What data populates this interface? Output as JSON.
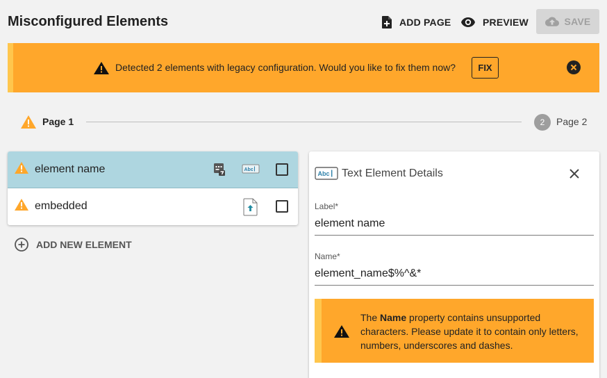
{
  "header": {
    "title": "Misconfigured Elements",
    "add_page_label": "ADD PAGE",
    "preview_label": "PREVIEW",
    "save_label": "SAVE"
  },
  "banner": {
    "message": "Detected 2 elements with legacy configuration. Would you like to fix them now?",
    "fix_label": "FIX"
  },
  "stepper": {
    "step1_label": "Page 1",
    "step2_number": "2",
    "step2_label": "Page 2"
  },
  "elements": [
    {
      "name": "element name",
      "selected": true
    },
    {
      "name": "embedded",
      "selected": false
    }
  ],
  "add_element_label": "ADD NEW ELEMENT",
  "details": {
    "title": "Text Element Details",
    "label_field_label": "Label*",
    "label_value": "element name",
    "name_field_label": "Name*",
    "name_value": "element_name$%^&*",
    "alert_prefix": "The ",
    "alert_bold": "Name",
    "alert_suffix": " property contains unsupported characters. Please update it to contain only letters, numbers, underscores and dashes."
  },
  "colors": {
    "warning": "#ffa72b",
    "warning_stripe": "#ffc64d",
    "selected_row": "#aed6e0",
    "save_disabled": "#d6d6d6"
  }
}
